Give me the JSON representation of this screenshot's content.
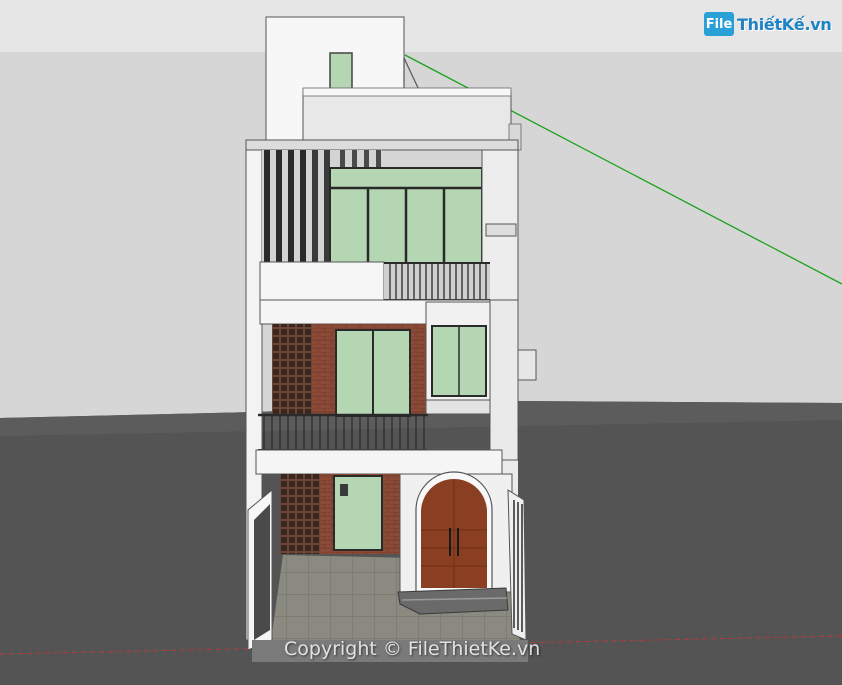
{
  "logo": {
    "mark": "File",
    "text": "ThiếtKế.vn"
  },
  "watermark": {
    "text": "Copyright © FileThietKe.vn"
  },
  "colors": {
    "sky": "#d6d6d6",
    "ground": "#545454",
    "wall": "#f4f4f4",
    "brick": "#8c4a36",
    "door": "#8a3e22",
    "glass": "#b4d6b2",
    "railing": "#2a2a2a",
    "axis_green": "#1ca31c",
    "axis_red": "#b53a3a"
  }
}
